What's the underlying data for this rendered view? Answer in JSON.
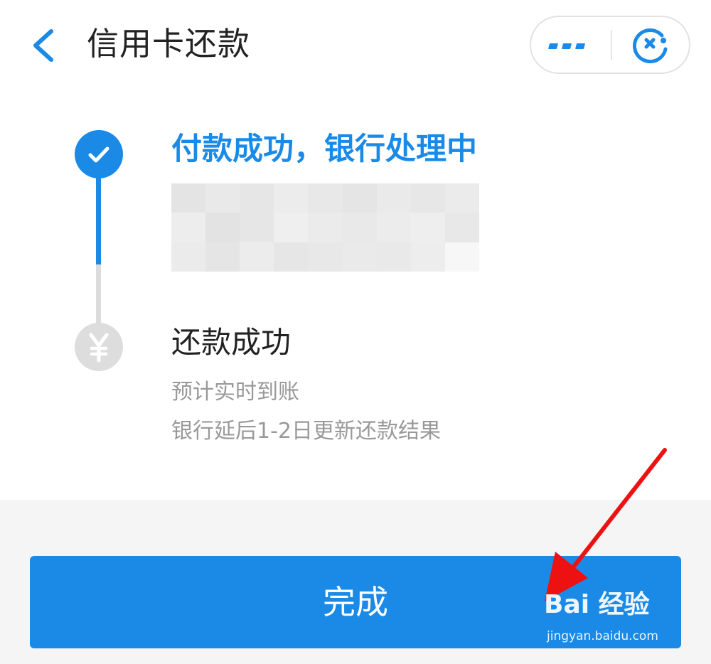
{
  "header": {
    "title": "信用卡还款",
    "back_icon": "chevron-left-icon",
    "more_icon": "more-dots-icon",
    "close_icon": "close-circle-icon"
  },
  "steps": [
    {
      "status": "done",
      "icon": "check-icon",
      "title": "付款成功，银行处理中"
    },
    {
      "status": "pending",
      "icon": "yen-icon",
      "title": "还款成功",
      "desc_line1": "预计实时到账",
      "desc_line2": "银行延后1-2日更新还款结果"
    }
  ],
  "done_button": {
    "label": "完成"
  },
  "watermark": {
    "logo_text": "Bai 经验",
    "url": "jingyan.baidu.com"
  },
  "colors": {
    "accent": "#1a8ae6",
    "pending_gray": "#dddddd",
    "annotation_red": "#ee1111"
  }
}
